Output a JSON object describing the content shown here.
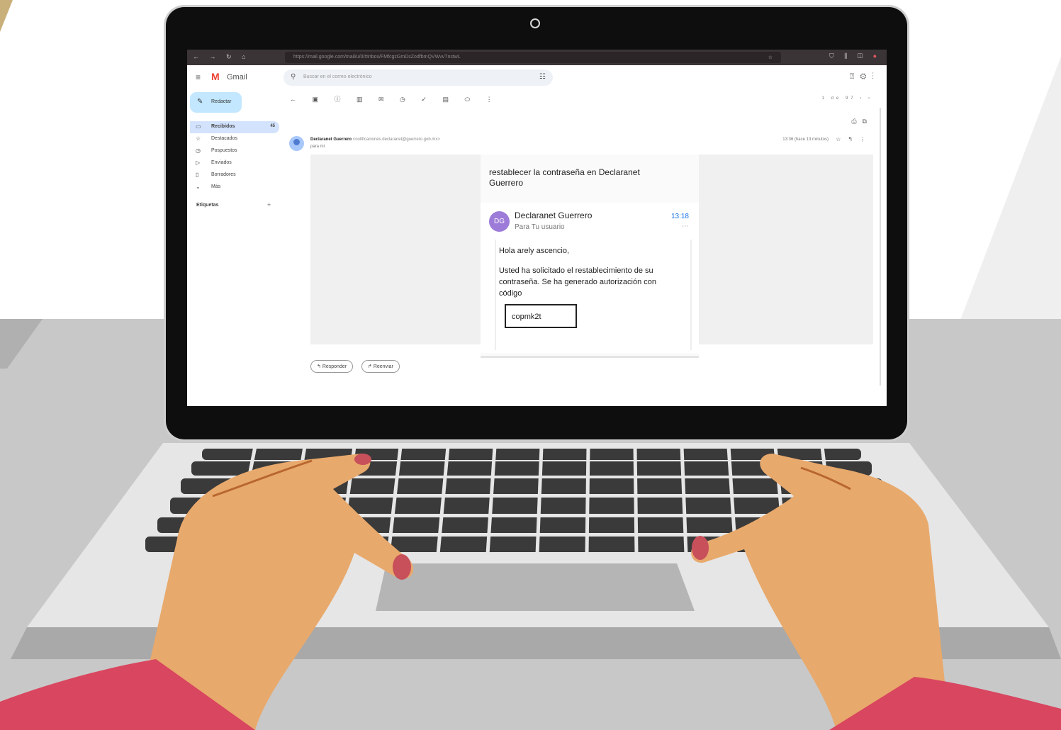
{
  "browser": {
    "url": "https://mail.google.com/mail/u/0/#inbox/FMfcgzGmDsZodfbmQVWvvTnstwL",
    "nav_icons": "← → ↻ ⌂",
    "ext_icons": "⛉ ⫼ ◫"
  },
  "gmail": {
    "app_name": "Gmail",
    "search_placeholder": "Buscar en el correo electrónico",
    "compose_label": "Redactar",
    "nav": [
      {
        "label": "Recibidos",
        "count": "45",
        "icon": "inbox-icon"
      },
      {
        "label": "Destacados",
        "icon": "star-icon"
      },
      {
        "label": "Pospuestos",
        "icon": "clock-icon"
      },
      {
        "label": "Enviados",
        "icon": "send-icon"
      },
      {
        "label": "Borradores",
        "icon": "draft-icon"
      },
      {
        "label": "Más",
        "icon": "chevron-down-icon"
      }
    ],
    "labels_heading": "Etiquetas",
    "pager": "1 de 97",
    "message": {
      "sender_name": "Declaranet Guerrero",
      "sender_email": "<notificaciones.declaranet@guerrero.gob.mx>",
      "to": "para mí",
      "time": "13:36 (hace 13 minutos)"
    },
    "email": {
      "subject": "restablecer la contraseña en Declaranet Guerrero",
      "avatar_initials": "DG",
      "from": "Declaranet Guerrero",
      "to": "Para Tu usuario",
      "time": "13:18",
      "greeting": "Hola arely ascencio,",
      "paragraph": "Usted ha solicitado el restablecimiento de su contraseña. Se ha generado autorización con código",
      "code": "copmk2t"
    },
    "reply_label": "Responder",
    "forward_label": "Reenviar"
  },
  "colors": {
    "compose_bg": "#c2e7ff",
    "active_nav_bg": "#d3e3fd",
    "avatar_purple": "#9d7bd8",
    "skin": "#e8a96c",
    "sleeve": "#d9465f",
    "nail": "#c8505a"
  }
}
